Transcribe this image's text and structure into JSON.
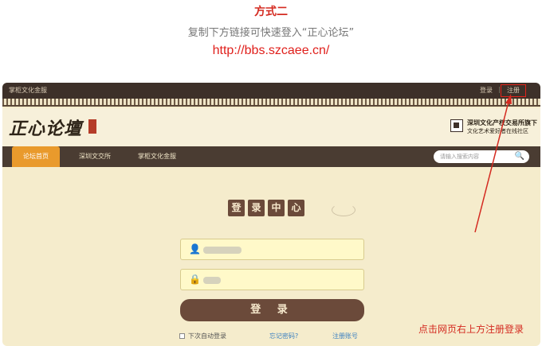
{
  "caption": {
    "heading": "方式二",
    "subheading": "复制下方链接可快速登入“正心论坛”",
    "url": "http://bbs.szcaee.cn/"
  },
  "site": {
    "topbar": {
      "brand": "掌柜文化金服",
      "login": "登录",
      "separator": "|",
      "register": "注册"
    },
    "logo_text": "正心论壇",
    "partner_line1": "深圳文化产权交易所旗下",
    "partner_line2": "文化艺术爱好者在线社区",
    "nav": {
      "tabs": [
        "论坛首页",
        "深圳文交所",
        "掌柜文化金服"
      ],
      "search_placeholder": "请输入搜索内容",
      "search_icon": "🔍"
    },
    "login_panel": {
      "title_chars": [
        "登",
        "录",
        "中",
        "心"
      ],
      "user_icon": "👤",
      "lock_icon": "🔒",
      "login_button": "登 录",
      "remember_me": "下次自动登录",
      "forgot_password": "忘记密码?",
      "register_link": "注册账号"
    }
  },
  "annotation": {
    "text": "点击网页右上方注册登录",
    "color": "#d42a20"
  }
}
